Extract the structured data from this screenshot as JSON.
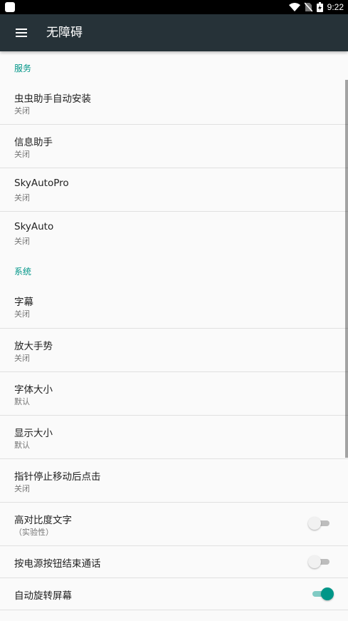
{
  "status_bar": {
    "time": "9:22",
    "icons": [
      "app-icon",
      "wifi-icon",
      "no-sim-icon",
      "battery-icon"
    ]
  },
  "app_bar": {
    "title": "无障碍",
    "menu_icon": "menu-icon",
    "background": "#263238"
  },
  "sections": [
    {
      "header": "服务",
      "items": [
        {
          "title": "虫虫助手自动安装",
          "summary": "关闭"
        },
        {
          "title": "信息助手",
          "summary": "关闭"
        },
        {
          "title": "SkyAutoPro",
          "summary": "关闭"
        },
        {
          "title": "SkyAuto",
          "summary": "关闭"
        }
      ]
    },
    {
      "header": "系统",
      "items": [
        {
          "title": "字幕",
          "summary": "关闭"
        },
        {
          "title": "放大手势",
          "summary": "关闭"
        },
        {
          "title": "字体大小",
          "summary": "默认"
        },
        {
          "title": "显示大小",
          "summary": "默认"
        },
        {
          "title": "指针停止移动后点击",
          "summary": "关闭"
        },
        {
          "title": "高对比度文字",
          "summary": "（实验性）",
          "switch": false
        },
        {
          "title": "按电源按钮结束通话",
          "switch": false
        },
        {
          "title": "自动旋转屏幕",
          "switch": true
        }
      ]
    }
  ],
  "colors": {
    "accent": "#009688",
    "background": "#fafafa",
    "divider": "#e0e0e0"
  }
}
